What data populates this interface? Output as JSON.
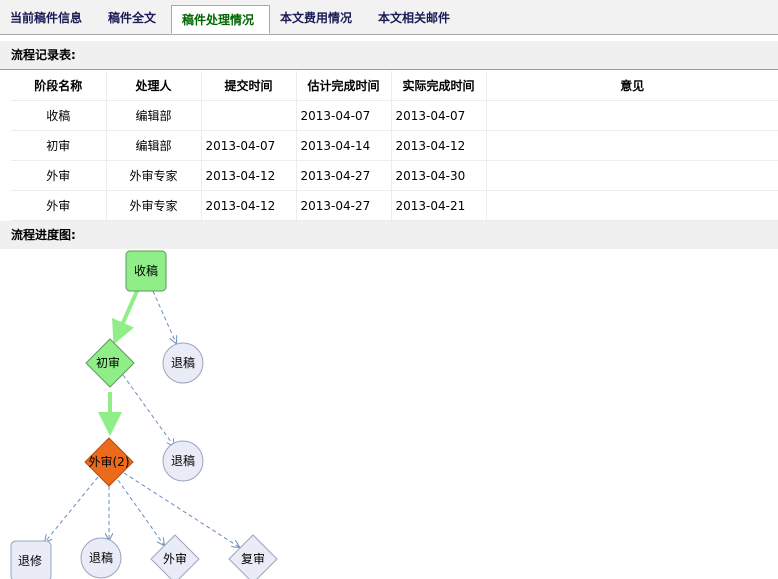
{
  "tabs": [
    {
      "label": "当前稿件信息",
      "active": false
    },
    {
      "label": "稿件全文",
      "active": false
    },
    {
      "label": "稿件处理情况",
      "active": true
    },
    {
      "label": "本文费用情况",
      "active": false
    },
    {
      "label": "本文相关邮件",
      "active": false
    }
  ],
  "records": {
    "title": "流程记录表:",
    "headers": [
      "阶段名称",
      "处理人",
      "提交时间",
      "估计完成时间",
      "实际完成时间",
      "意见"
    ],
    "rows": [
      [
        "收稿",
        "编辑部",
        "",
        "2013-04-07",
        "2013-04-07",
        ""
      ],
      [
        "初审",
        "编辑部",
        "2013-04-07",
        "2013-04-14",
        "2013-04-12",
        ""
      ],
      [
        "外审",
        "外审专家",
        "2013-04-12",
        "2013-04-27",
        "2013-04-30",
        ""
      ],
      [
        "外审",
        "外审专家",
        "2013-04-12",
        "2013-04-27",
        "2013-04-21",
        ""
      ]
    ]
  },
  "flow": {
    "title": "流程进度图:",
    "colors": {
      "done": "#90ee88",
      "current": "#ec6a1c",
      "pending": "#e9ecf7",
      "pending_stroke": "#9aa4c0",
      "done_edge": "#90ee88",
      "pending_edge": "#6b8cc0"
    },
    "nodes": {
      "receive": "收稿",
      "reject1": "退稿",
      "first_review": "初审",
      "reject2": "退稿",
      "external_review": "外审(2)",
      "revise": "退修",
      "reject3": "退稿",
      "external2": "外审",
      "re_review": "复审"
    }
  }
}
